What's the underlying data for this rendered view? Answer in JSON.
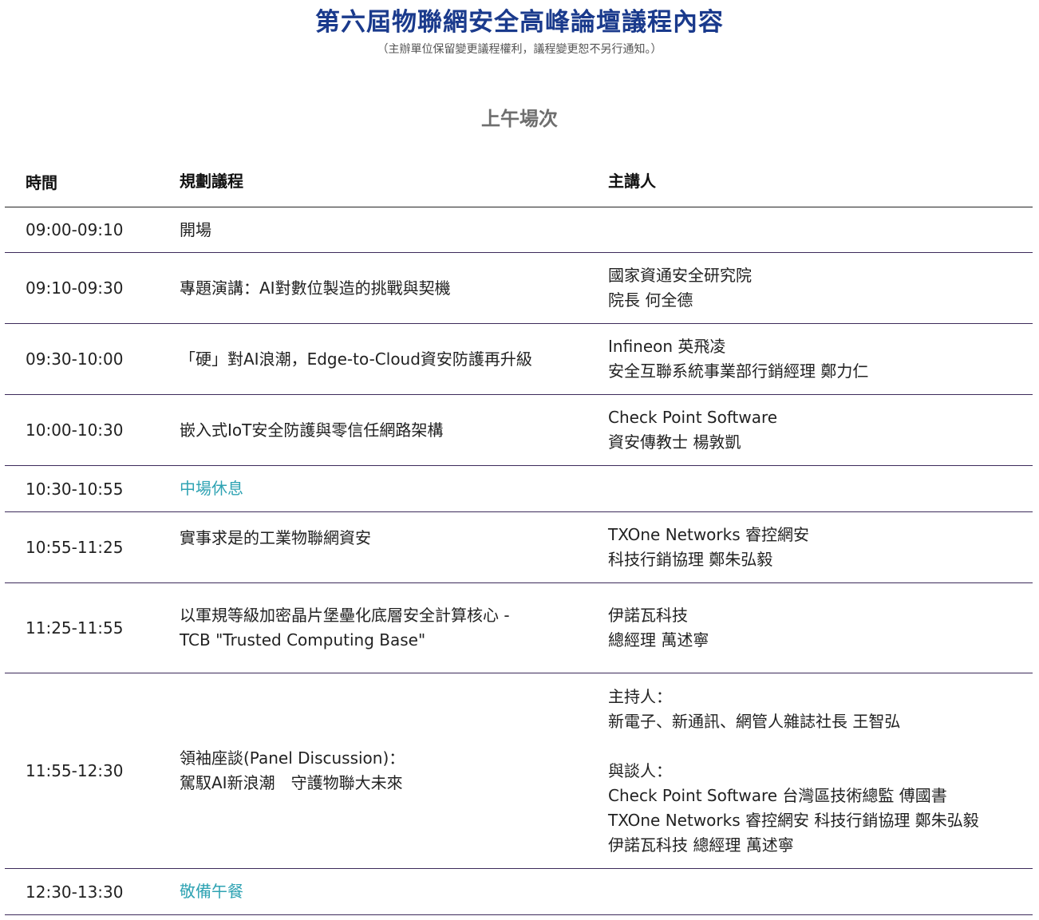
{
  "page": {
    "title": "第六屆物聯網安全高峰論壇議程內容",
    "notice": "（主辦單位保留變更議程權利，議程變更恕不另行通知。）",
    "section_title": "上午場次"
  },
  "colors": {
    "title": "#1a3a8c",
    "break_text": "#2fa3b3",
    "divider": "#3c2a5a"
  },
  "table": {
    "headers": {
      "time": "時間",
      "topic": "規劃議程",
      "speaker": "主講人"
    },
    "rows": [
      {
        "time": "09:00-09:10",
        "topic": [
          "開場"
        ],
        "speaker": []
      },
      {
        "time": "09:10-09:30",
        "topic": [
          "專題演講：AI對數位製造的挑戰與契機"
        ],
        "speaker": [
          "國家資通安全研究院",
          "院長 何全德"
        ]
      },
      {
        "time": "09:30-10:00",
        "topic": [
          "「硬」對AI浪潮，Edge-to-Cloud資安防護再升級"
        ],
        "speaker": [
          "Infineon 英飛凌",
          "安全互聯系統事業部行銷經理 鄭力仁"
        ]
      },
      {
        "time": "10:00-10:30",
        "topic": [
          "嵌入式IoT安全防護與零信任網路架構"
        ],
        "speaker": [
          "Check Point Software",
          "資安傳教士 楊敦凱"
        ]
      },
      {
        "time": "10:30-10:55",
        "topic": [
          "中場休息"
        ],
        "speaker": []
      },
      {
        "time": "10:55-11:25",
        "topic": [
          "實事求是的工業物聯網資安"
        ],
        "speaker": [
          "TXOne Networks 睿控網安",
          "科技行銷協理 鄭朱弘毅"
        ]
      },
      {
        "time": "11:25-11:55",
        "topic": [
          "以軍規等級加密晶片堡壘化底層安全計算核心 -",
          "TCB \"Trusted Computing Base\""
        ],
        "speaker": [
          "伊諾瓦科技",
          "總經理 萬述寧"
        ]
      },
      {
        "time": "11:55-12:30",
        "topic": [
          "領袖座談(Panel Discussion)：",
          "駕馭AI新浪潮　守護物聯大未來"
        ],
        "speaker": [
          "主持人：",
          "新電子、新通訊、網管人雜誌社長 王智弘",
          "",
          "與談人：",
          "Check Point Software 台灣區技術總監 傅國書",
          "TXOne Networks 睿控網安 科技行銷協理 鄭朱弘毅",
          "伊諾瓦科技 總經理 萬述寧"
        ]
      },
      {
        "time": "12:30-13:30",
        "topic": [
          "敬備午餐"
        ],
        "speaker": []
      }
    ]
  }
}
